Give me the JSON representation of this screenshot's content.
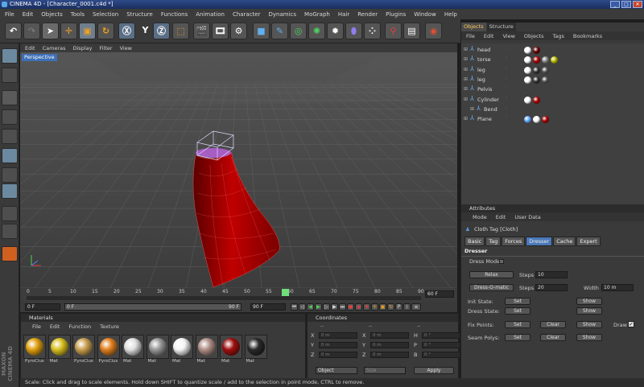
{
  "window": {
    "title": "CINEMA 4D - [Character_0001.c4d *]"
  },
  "menu": [
    "File",
    "Edit",
    "Objects",
    "Tools",
    "Selection",
    "Structure",
    "Functions",
    "Animation",
    "Character",
    "Dynamics",
    "MoGraph",
    "Hair",
    "Render",
    "Plugins",
    "Window",
    "Help"
  ],
  "viewport": {
    "menu": [
      "Edit",
      "Cameras",
      "Display",
      "Filter",
      "View"
    ],
    "label": "Perspective"
  },
  "timeline": {
    "ticks": [
      "0",
      "5",
      "10",
      "15",
      "20",
      "25",
      "30",
      "35",
      "40",
      "45",
      "50",
      "55",
      "60",
      "65",
      "70",
      "75",
      "80",
      "85",
      "90"
    ],
    "current_frame": "60 F",
    "end_frame_field": "90 F",
    "start_field": "0 F",
    "min_field": "0 F",
    "max_field": "90 F",
    "max_field2": "90 F"
  },
  "materials": {
    "title": "Materials",
    "menu": [
      "File",
      "Edit",
      "Function",
      "Texture"
    ],
    "items": [
      {
        "name": "PyroClus",
        "color": "#e0a010"
      },
      {
        "name": "Mat",
        "color": "#d8c020"
      },
      {
        "name": "PyroClus",
        "color": "#caa050"
      },
      {
        "name": "PyroClus",
        "color": "#e08020"
      },
      {
        "name": "Mat",
        "color": "#e0e0e0"
      },
      {
        "name": "Mat",
        "color": "#999999"
      },
      {
        "name": "Mat",
        "color": "#f4f4f4"
      },
      {
        "name": "Mat",
        "color": "#b09088"
      },
      {
        "name": "Mat",
        "color": "#a01010"
      },
      {
        "name": "Mat",
        "color": "#2a2a2a"
      }
    ]
  },
  "coordinates": {
    "title": "Coordinates",
    "col1": "--",
    "col2": "--",
    "col3": "--",
    "rows": [
      {
        "a": "X",
        "av": "0 m",
        "b": "X",
        "bv": "0 m",
        "c": "H",
        "cv": "0 °"
      },
      {
        "a": "Y",
        "av": "0 m",
        "b": "Y",
        "bv": "0 m",
        "c": "P",
        "cv": "0 °"
      },
      {
        "a": "Z",
        "av": "0 m",
        "b": "Z",
        "bv": "0 m",
        "c": "B",
        "cv": "0 °"
      }
    ],
    "mode": "Object",
    "size": "Size",
    "apply": "Apply"
  },
  "objects": {
    "tabs": [
      "Objects",
      "Structure"
    ],
    "menu": [
      "File",
      "Edit",
      "View",
      "Objects",
      "Tags",
      "Bookmarks"
    ],
    "rows": [
      {
        "name": "head",
        "indent": 0
      },
      {
        "name": "torse",
        "indent": 0
      },
      {
        "name": "leg",
        "indent": 0
      },
      {
        "name": "leg",
        "indent": 0
      },
      {
        "name": "Pelvis",
        "indent": 0
      },
      {
        "name": "Cylinder",
        "indent": 0
      },
      {
        "name": "Bend",
        "indent": 1
      },
      {
        "name": "Plane",
        "indent": 0
      }
    ]
  },
  "attributes": {
    "title": "Attributes",
    "menu": [
      "Mode",
      "Edit",
      "User Data"
    ],
    "tag_title": "Cloth Tag [Cloth]",
    "tabs": [
      "Basic",
      "Tag",
      "Forces",
      "Dresser",
      "Cache",
      "Expert"
    ],
    "active_tab": "Dresser",
    "section": "Dresser",
    "dress_mode": "Dress Mode",
    "relax": "Relax",
    "steps_label": "Steps",
    "relax_steps": "10",
    "dress_o_matic": "Dress-O-matic",
    "dress_steps": "20",
    "width_label": "Width",
    "width_value": "10 m",
    "rows": [
      {
        "label": "Init State:",
        "set": "Set",
        "show": "Show"
      },
      {
        "label": "Dress State:",
        "set": "Set",
        "show": "Show"
      }
    ],
    "fix_points": {
      "label": "Fix Points:",
      "set": "Set",
      "clear": "Clear",
      "show": "Show",
      "draw": "Draw"
    },
    "seam_polys": {
      "label": "Seam Polys:",
      "set": "Set",
      "clear": "Clear",
      "show": "Show"
    }
  },
  "status": "Scale: Click and drag to scale elements. Hold down SHIFT to quantize scale / add to the selection in point mode, CTRL to remove.",
  "brand": "MAXON CINEMA 4D"
}
